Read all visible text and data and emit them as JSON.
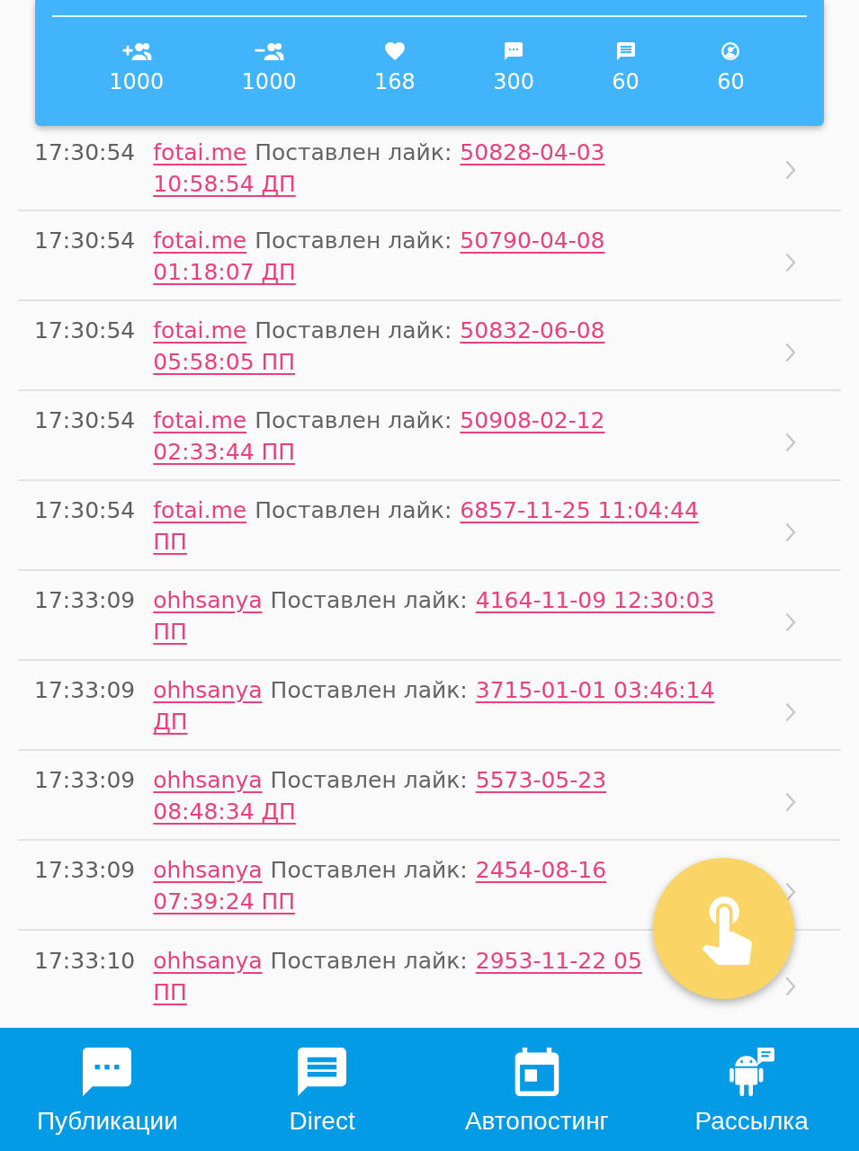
{
  "stats_card": {
    "stats": [
      {
        "value": "1000"
      },
      {
        "value": "1000"
      },
      {
        "value": "168"
      },
      {
        "value": "300"
      },
      {
        "value": "60"
      },
      {
        "value": "60"
      }
    ]
  },
  "feed": [
    {
      "time": "17:30:54",
      "user": "fotai.me",
      "action": "Поставлен лайк:",
      "date_lines": [
        "50828-04-03",
        "10:58:54 ДП"
      ]
    },
    {
      "time": "17:30:54",
      "user": "fotai.me",
      "action": "Поставлен лайк:",
      "date_lines": [
        "50790-04-08",
        "01:18:07 ДП"
      ]
    },
    {
      "time": "17:30:54",
      "user": "fotai.me",
      "action": "Поставлен лайк:",
      "date_lines": [
        "50832-06-08",
        "05:58:05 ПП"
      ]
    },
    {
      "time": "17:30:54",
      "user": "fotai.me",
      "action": "Поставлен лайк:",
      "date_lines": [
        "50908-02-12",
        "02:33:44 ПП"
      ]
    },
    {
      "time": "17:30:54",
      "user": "fotai.me",
      "action": "Поставлен лайк:",
      "date_lines": [
        "6857-11-25 11:04:44",
        "ПП"
      ]
    },
    {
      "time": "17:33:09",
      "user": "ohhsanya",
      "action": "Поставлен лайк:",
      "date_lines": [
        "4164-11-09 12:30:03",
        "ПП"
      ]
    },
    {
      "time": "17:33:09",
      "user": "ohhsanya",
      "action": "Поставлен лайк:",
      "date_lines": [
        "3715-01-01 03:46:14",
        "ДП"
      ]
    },
    {
      "time": "17:33:09",
      "user": "ohhsanya",
      "action": "Поставлен лайк:",
      "date_lines": [
        "5573-05-23",
        "08:48:34 ДП"
      ]
    },
    {
      "time": "17:33:09",
      "user": "ohhsanya",
      "action": "Поставлен лайк:",
      "date_lines": [
        "2454-08-16",
        "07:39:24 ПП"
      ]
    },
    {
      "time": "17:33:10",
      "user": "ohhsanya",
      "action": "Поставлен лайк:",
      "date_lines": [
        "2953-11-22 05",
        "ПП"
      ]
    }
  ],
  "bottom_nav": {
    "items": [
      {
        "label": "Публикации"
      },
      {
        "label": "Direct"
      },
      {
        "label": "Автопостинг"
      },
      {
        "label": "Рассылка"
      }
    ]
  }
}
